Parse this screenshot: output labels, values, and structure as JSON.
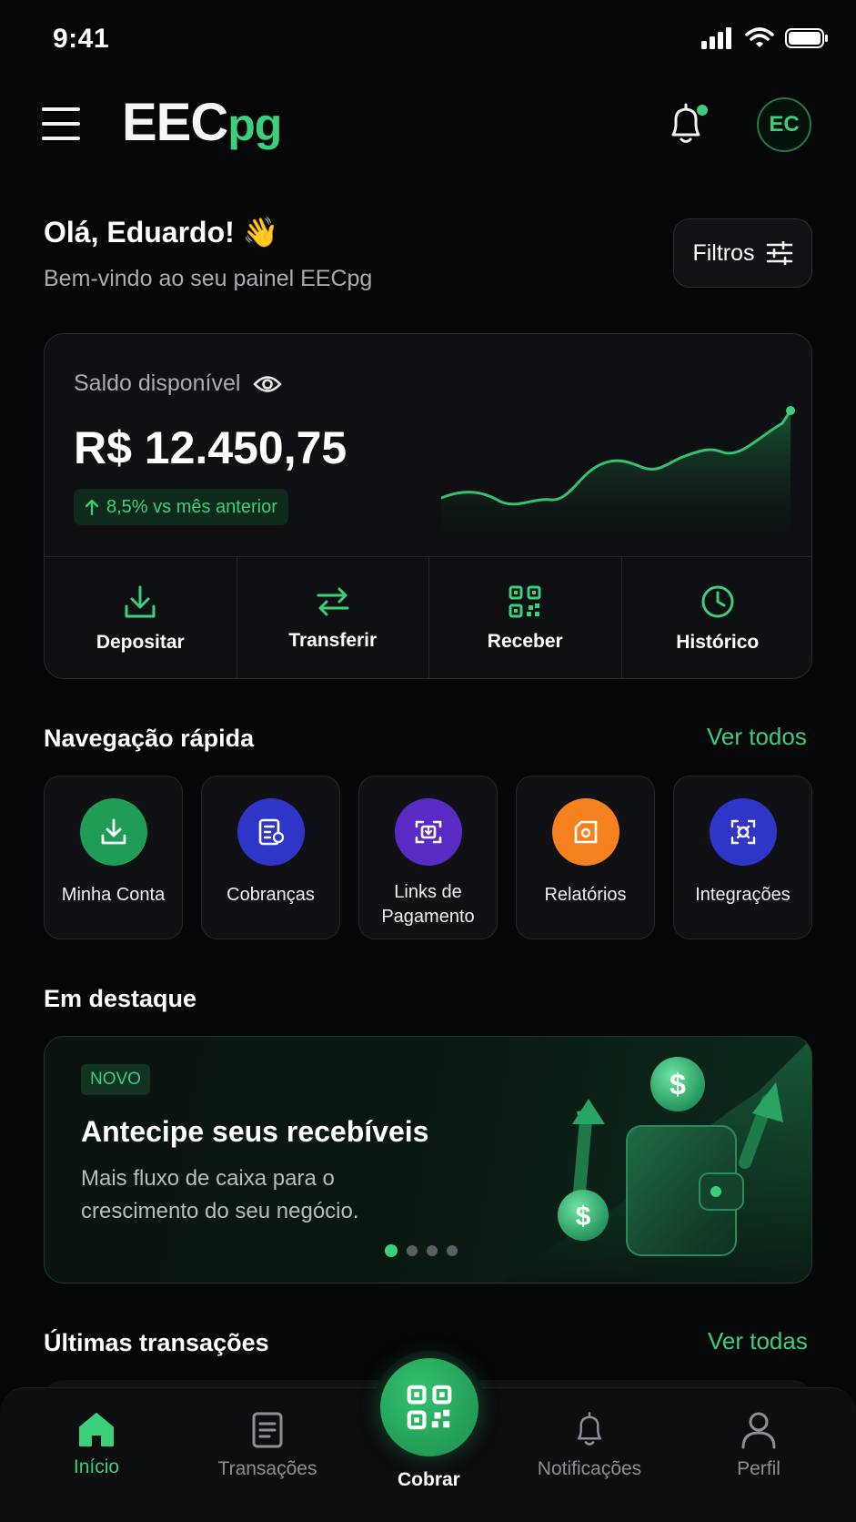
{
  "status_bar": {
    "time": "9:41"
  },
  "header": {
    "logo_main": "EEC",
    "logo_sub": "pg",
    "avatar_initials": "EC"
  },
  "greeting": {
    "title": "Olá, Eduardo! 👋",
    "subtitle": "Bem-vindo ao seu painel EECpg",
    "filters_label": "Filtros"
  },
  "balance": {
    "label": "Saldo disponível",
    "value": "R$ 12.450,75",
    "change": "8,5% vs mês anterior",
    "actions": [
      {
        "label": "Depositar",
        "icon": "download-icon"
      },
      {
        "label": "Transferir",
        "icon": "transfer-icon"
      },
      {
        "label": "Receber",
        "icon": "qr-code-icon"
      },
      {
        "label": "Histórico",
        "icon": "clock-icon"
      }
    ]
  },
  "quick_nav": {
    "title": "Navegação rápida",
    "link": "Ver todos",
    "items": [
      {
        "label": "Minha Conta",
        "color": "#1f9d57",
        "icon": "download-icon"
      },
      {
        "label": "Cobranças",
        "color": "#2f35c9",
        "icon": "invoice-icon"
      },
      {
        "label": "Links de Pagamento",
        "color": "#5a2bc4",
        "icon": "payment-link-icon"
      },
      {
        "label": "Relatórios",
        "color": "#f5821f",
        "icon": "report-icon"
      },
      {
        "label": "Integrações",
        "color": "#2f35c9",
        "icon": "integration-icon"
      }
    ]
  },
  "featured": {
    "title": "Em destaque",
    "badge": "NOVO",
    "heading": "Antecipe seus recebíveis",
    "text": "Mais fluxo de caixa para o crescimento do seu negócio.",
    "active_slide": 1,
    "slides": 4
  },
  "transactions": {
    "title": "Últimas transações",
    "link": "Ver todas"
  },
  "bottom_nav": {
    "items": [
      {
        "label": "Início",
        "icon": "home-icon",
        "active": true
      },
      {
        "label": "Transações",
        "icon": "document-icon"
      },
      {
        "label": "Cobrar",
        "icon": "qr-code-icon"
      },
      {
        "label": "Notificações",
        "icon": "bell-icon"
      },
      {
        "label": "Perfil",
        "icon": "user-icon"
      }
    ]
  },
  "colors": {
    "accent": "#3ccf7a",
    "background": "#050607",
    "card": "#0e1013"
  }
}
